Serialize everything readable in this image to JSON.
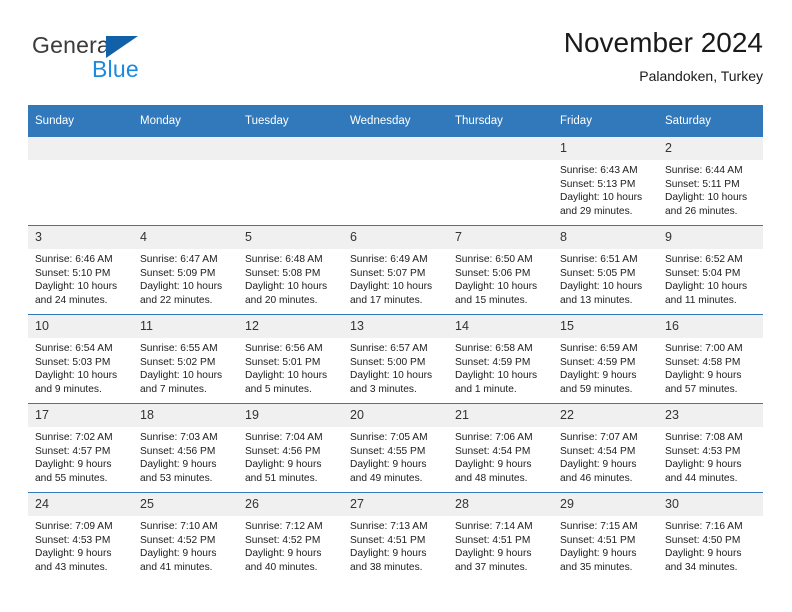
{
  "logo": {
    "text_primary": "General",
    "text_secondary": "Blue",
    "icon": "triangle-icon",
    "accent_color": "#1061a8",
    "secondary_color": "#1b8ae0"
  },
  "header": {
    "title": "November 2024",
    "subtitle": "Palandoken, Turkey"
  },
  "theme": {
    "header_row_background": "#3179ba",
    "header_row_text": "#ffffff",
    "date_band_background": "#f0f0f0",
    "row_separator": "#3179ba"
  },
  "weekdays": [
    "Sunday",
    "Monday",
    "Tuesday",
    "Wednesday",
    "Thursday",
    "Friday",
    "Saturday"
  ],
  "weeks": [
    [
      {
        "day": "",
        "empty": true
      },
      {
        "day": "",
        "empty": true
      },
      {
        "day": "",
        "empty": true
      },
      {
        "day": "",
        "empty": true
      },
      {
        "day": "",
        "empty": true
      },
      {
        "day": "1",
        "sunrise": "Sunrise: 6:43 AM",
        "sunset": "Sunset: 5:13 PM",
        "daylight": "Daylight: 10 hours and 29 minutes."
      },
      {
        "day": "2",
        "sunrise": "Sunrise: 6:44 AM",
        "sunset": "Sunset: 5:11 PM",
        "daylight": "Daylight: 10 hours and 26 minutes."
      }
    ],
    [
      {
        "day": "3",
        "sunrise": "Sunrise: 6:46 AM",
        "sunset": "Sunset: 5:10 PM",
        "daylight": "Daylight: 10 hours and 24 minutes."
      },
      {
        "day": "4",
        "sunrise": "Sunrise: 6:47 AM",
        "sunset": "Sunset: 5:09 PM",
        "daylight": "Daylight: 10 hours and 22 minutes."
      },
      {
        "day": "5",
        "sunrise": "Sunrise: 6:48 AM",
        "sunset": "Sunset: 5:08 PM",
        "daylight": "Daylight: 10 hours and 20 minutes."
      },
      {
        "day": "6",
        "sunrise": "Sunrise: 6:49 AM",
        "sunset": "Sunset: 5:07 PM",
        "daylight": "Daylight: 10 hours and 17 minutes."
      },
      {
        "day": "7",
        "sunrise": "Sunrise: 6:50 AM",
        "sunset": "Sunset: 5:06 PM",
        "daylight": "Daylight: 10 hours and 15 minutes."
      },
      {
        "day": "8",
        "sunrise": "Sunrise: 6:51 AM",
        "sunset": "Sunset: 5:05 PM",
        "daylight": "Daylight: 10 hours and 13 minutes."
      },
      {
        "day": "9",
        "sunrise": "Sunrise: 6:52 AM",
        "sunset": "Sunset: 5:04 PM",
        "daylight": "Daylight: 10 hours and 11 minutes."
      }
    ],
    [
      {
        "day": "10",
        "sunrise": "Sunrise: 6:54 AM",
        "sunset": "Sunset: 5:03 PM",
        "daylight": "Daylight: 10 hours and 9 minutes."
      },
      {
        "day": "11",
        "sunrise": "Sunrise: 6:55 AM",
        "sunset": "Sunset: 5:02 PM",
        "daylight": "Daylight: 10 hours and 7 minutes."
      },
      {
        "day": "12",
        "sunrise": "Sunrise: 6:56 AM",
        "sunset": "Sunset: 5:01 PM",
        "daylight": "Daylight: 10 hours and 5 minutes."
      },
      {
        "day": "13",
        "sunrise": "Sunrise: 6:57 AM",
        "sunset": "Sunset: 5:00 PM",
        "daylight": "Daylight: 10 hours and 3 minutes."
      },
      {
        "day": "14",
        "sunrise": "Sunrise: 6:58 AM",
        "sunset": "Sunset: 4:59 PM",
        "daylight": "Daylight: 10 hours and 1 minute."
      },
      {
        "day": "15",
        "sunrise": "Sunrise: 6:59 AM",
        "sunset": "Sunset: 4:59 PM",
        "daylight": "Daylight: 9 hours and 59 minutes."
      },
      {
        "day": "16",
        "sunrise": "Sunrise: 7:00 AM",
        "sunset": "Sunset: 4:58 PM",
        "daylight": "Daylight: 9 hours and 57 minutes."
      }
    ],
    [
      {
        "day": "17",
        "sunrise": "Sunrise: 7:02 AM",
        "sunset": "Sunset: 4:57 PM",
        "daylight": "Daylight: 9 hours and 55 minutes."
      },
      {
        "day": "18",
        "sunrise": "Sunrise: 7:03 AM",
        "sunset": "Sunset: 4:56 PM",
        "daylight": "Daylight: 9 hours and 53 minutes."
      },
      {
        "day": "19",
        "sunrise": "Sunrise: 7:04 AM",
        "sunset": "Sunset: 4:56 PM",
        "daylight": "Daylight: 9 hours and 51 minutes."
      },
      {
        "day": "20",
        "sunrise": "Sunrise: 7:05 AM",
        "sunset": "Sunset: 4:55 PM",
        "daylight": "Daylight: 9 hours and 49 minutes."
      },
      {
        "day": "21",
        "sunrise": "Sunrise: 7:06 AM",
        "sunset": "Sunset: 4:54 PM",
        "daylight": "Daylight: 9 hours and 48 minutes."
      },
      {
        "day": "22",
        "sunrise": "Sunrise: 7:07 AM",
        "sunset": "Sunset: 4:54 PM",
        "daylight": "Daylight: 9 hours and 46 minutes."
      },
      {
        "day": "23",
        "sunrise": "Sunrise: 7:08 AM",
        "sunset": "Sunset: 4:53 PM",
        "daylight": "Daylight: 9 hours and 44 minutes."
      }
    ],
    [
      {
        "day": "24",
        "sunrise": "Sunrise: 7:09 AM",
        "sunset": "Sunset: 4:53 PM",
        "daylight": "Daylight: 9 hours and 43 minutes."
      },
      {
        "day": "25",
        "sunrise": "Sunrise: 7:10 AM",
        "sunset": "Sunset: 4:52 PM",
        "daylight": "Daylight: 9 hours and 41 minutes."
      },
      {
        "day": "26",
        "sunrise": "Sunrise: 7:12 AM",
        "sunset": "Sunset: 4:52 PM",
        "daylight": "Daylight: 9 hours and 40 minutes."
      },
      {
        "day": "27",
        "sunrise": "Sunrise: 7:13 AM",
        "sunset": "Sunset: 4:51 PM",
        "daylight": "Daylight: 9 hours and 38 minutes."
      },
      {
        "day": "28",
        "sunrise": "Sunrise: 7:14 AM",
        "sunset": "Sunset: 4:51 PM",
        "daylight": "Daylight: 9 hours and 37 minutes."
      },
      {
        "day": "29",
        "sunrise": "Sunrise: 7:15 AM",
        "sunset": "Sunset: 4:51 PM",
        "daylight": "Daylight: 9 hours and 35 minutes."
      },
      {
        "day": "30",
        "sunrise": "Sunrise: 7:16 AM",
        "sunset": "Sunset: 4:50 PM",
        "daylight": "Daylight: 9 hours and 34 minutes."
      }
    ]
  ]
}
